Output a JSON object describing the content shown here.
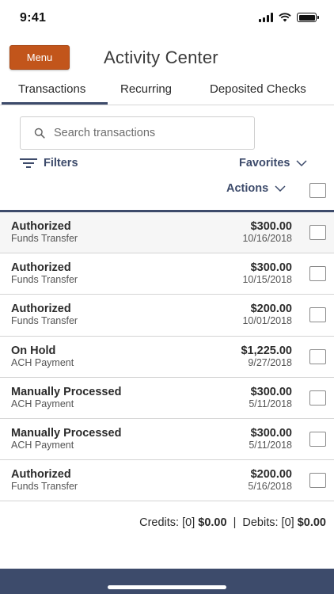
{
  "status_bar": {
    "time": "9:41"
  },
  "header": {
    "menu_label": "Menu",
    "title": "Activity Center"
  },
  "tabs": [
    {
      "label": "Transactions",
      "active": true
    },
    {
      "label": "Recurring",
      "active": false
    },
    {
      "label": "Deposited Checks",
      "active": false
    }
  ],
  "search": {
    "placeholder": "Search transactions"
  },
  "toolbar": {
    "filters_label": "Filters",
    "favorites_label": "Favorites",
    "actions_label": "Actions"
  },
  "transactions": [
    {
      "status": "Authorized",
      "type": "Funds Transfer",
      "amount": "$300.00",
      "date": "10/16/2018"
    },
    {
      "status": "Authorized",
      "type": "Funds Transfer",
      "amount": "$300.00",
      "date": "10/15/2018"
    },
    {
      "status": "Authorized",
      "type": "Funds Transfer",
      "amount": "$200.00",
      "date": "10/01/2018"
    },
    {
      "status": "On Hold",
      "type": "ACH Payment",
      "amount": "$1,225.00",
      "date": "9/27/2018"
    },
    {
      "status": "Manually Processed",
      "type": "ACH Payment",
      "amount": "$300.00",
      "date": "5/11/2018"
    },
    {
      "status": "Manually Processed",
      "type": "ACH Payment",
      "amount": "$300.00",
      "date": "5/11/2018"
    },
    {
      "status": "Authorized",
      "type": "Funds Transfer",
      "amount": "$200.00",
      "date": "5/16/2018"
    }
  ],
  "totals": {
    "credits_label": "Credits: [0]",
    "credits_amount": "$0.00",
    "separator": "|",
    "debits_label": "Debits: [0]",
    "debits_amount": "$0.00"
  },
  "colors": {
    "accent": "#3d4b6b",
    "menu_button": "#c2551b"
  },
  "icons": {
    "filters": "filter-lines-icon",
    "search": "search-icon",
    "dropdown": "chevron-down-icon"
  }
}
